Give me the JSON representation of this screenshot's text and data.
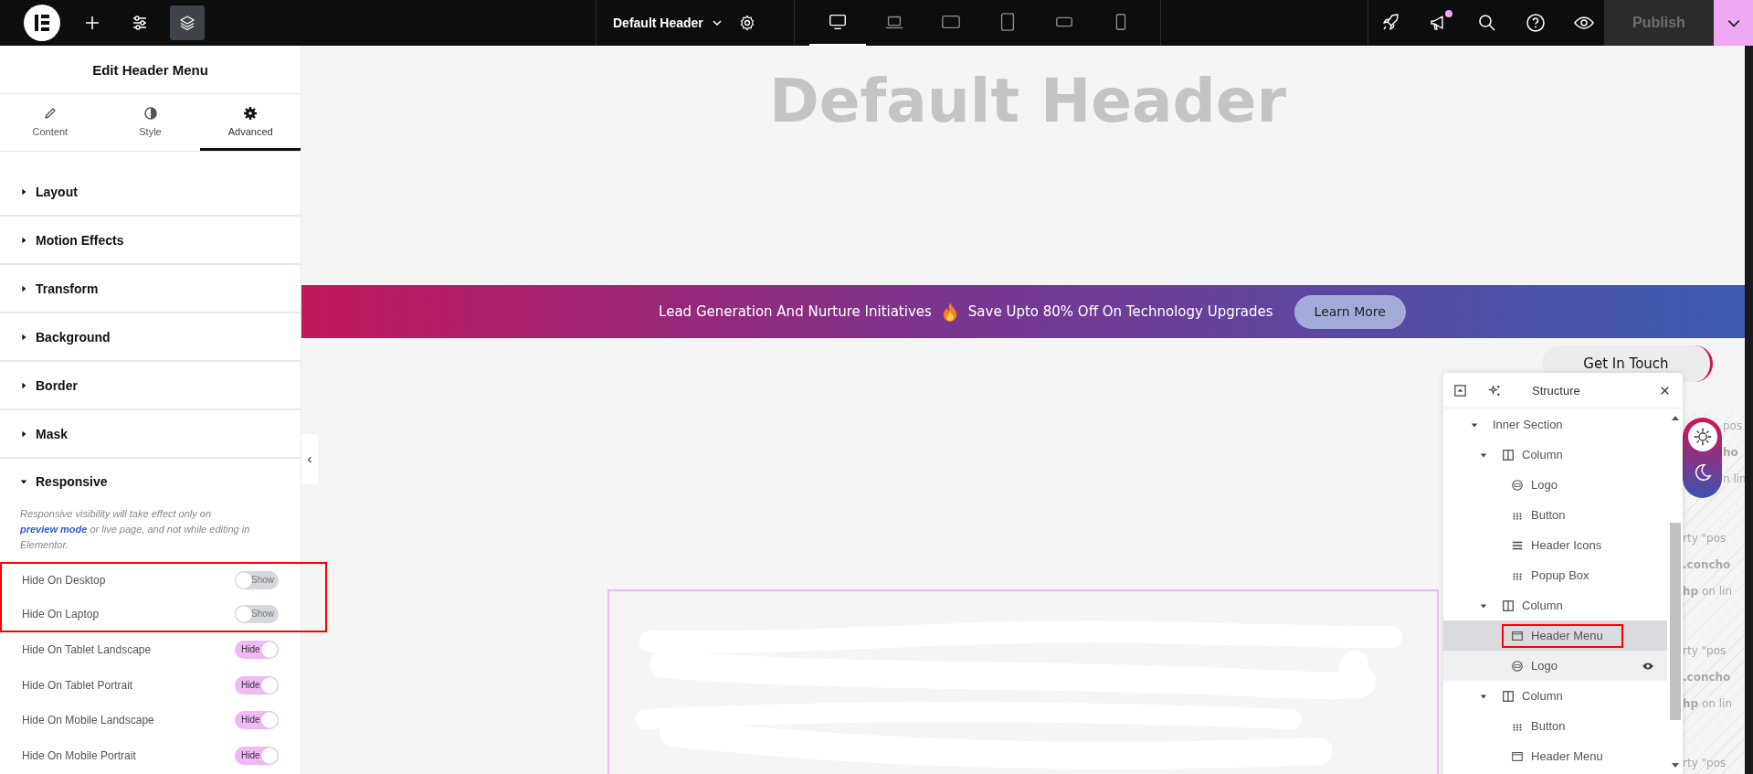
{
  "top_bar": {
    "tools": [
      {
        "kind": "add",
        "selected": false
      },
      {
        "kind": "sliders",
        "selected": false
      },
      {
        "kind": "layers",
        "selected": true
      }
    ],
    "document": {
      "title": "Default Header"
    },
    "devices": [
      {
        "kind": "desktop",
        "selected": true
      },
      {
        "kind": "laptop",
        "selected": false
      },
      {
        "kind": "tablet-landscape",
        "selected": false
      },
      {
        "kind": "tablet-portrait",
        "selected": false
      },
      {
        "kind": "mobile-landscape",
        "selected": false
      },
      {
        "kind": "mobile-portrait",
        "selected": false
      }
    ],
    "actions": [
      {
        "kind": "rocket",
        "badge": false
      },
      {
        "kind": "megaphone",
        "badge": true
      },
      {
        "kind": "search",
        "badge": false
      },
      {
        "kind": "help",
        "badge": false
      },
      {
        "kind": "eye",
        "badge": false
      }
    ],
    "publish": {
      "label": "Publish",
      "disabled": true
    }
  },
  "panel": {
    "title": "Edit Header Menu",
    "tabs": [
      {
        "label": "Content",
        "kind": "pencil",
        "selected": false
      },
      {
        "label": "Style",
        "kind": "contrast",
        "selected": false
      },
      {
        "label": "Advanced",
        "kind": "gear",
        "selected": true
      }
    ],
    "sections": [
      {
        "label": "Layout",
        "expanded": false
      },
      {
        "label": "Motion Effects",
        "expanded": false
      },
      {
        "label": "Transform",
        "expanded": false
      },
      {
        "label": "Background",
        "expanded": false
      },
      {
        "label": "Border",
        "expanded": false
      },
      {
        "label": "Mask",
        "expanded": false
      },
      {
        "label": "Responsive",
        "expanded": true
      }
    ],
    "note": {
      "before": "Responsive visibility will take effect only on ",
      "link": "preview mode",
      "after": " or live page, and not while editing in Elementor."
    },
    "toggles": [
      {
        "label": "Hide On Desktop",
        "state_label": "Show",
        "on": false,
        "highlighted": true
      },
      {
        "label": "Hide On Laptop",
        "state_label": "Show",
        "on": false,
        "highlighted": true
      },
      {
        "label": "Hide On Tablet Landscape",
        "state_label": "Hide",
        "on": true,
        "highlighted": false
      },
      {
        "label": "Hide On Tablet Portrait",
        "state_label": "Hide",
        "on": true,
        "highlighted": false
      },
      {
        "label": "Hide On Mobile Landscape",
        "state_label": "Hide",
        "on": true,
        "highlighted": false
      },
      {
        "label": "Hide On Mobile Portrait",
        "state_label": "Hide",
        "on": true,
        "highlighted": false
      }
    ]
  },
  "canvas": {
    "heading": "Default Header",
    "banner": {
      "text_1": "Lead Generation And Nurture Initiatives",
      "text_2": "Save Upto 80% Off On Technology Upgrades",
      "button": "Learn More"
    },
    "contact_button": "Get In Touch",
    "theme_switch": {
      "dark": false
    },
    "background_fragments": [
      [
        "pos",
        "**ho**",
        "n lin"
      ],
      [
        "rty \"pos",
        "**.concho**",
        "**hp** on lin"
      ],
      [
        "rty \"pos",
        "**.concho**",
        "**hp** on lin"
      ],
      [
        "rty \"pos"
      ]
    ]
  },
  "structure": {
    "title": "Structure",
    "tree": [
      {
        "label": "Inner Section",
        "kind": "section",
        "expanded": true,
        "selected": false,
        "hovered": false,
        "highlighted": false,
        "children": [
          {
            "label": "Column",
            "kind": "column",
            "expanded": true,
            "selected": false,
            "hovered": false,
            "highlighted": false,
            "children": [
              {
                "label": "Logo",
                "kind": "image",
                "selected": false,
                "hovered": false,
                "highlighted": false
              },
              {
                "label": "Button",
                "kind": "button",
                "selected": false,
                "hovered": false,
                "highlighted": false
              },
              {
                "label": "Header Icons",
                "kind": "menu",
                "selected": false,
                "hovered": false,
                "highlighted": false
              },
              {
                "label": "Popup Box",
                "kind": "button",
                "selected": false,
                "hovered": false,
                "highlighted": false
              }
            ]
          },
          {
            "label": "Column",
            "kind": "column",
            "expanded": true,
            "selected": false,
            "hovered": false,
            "highlighted": false,
            "children": [
              {
                "label": "Header Menu",
                "kind": "window",
                "selected": true,
                "hovered": false,
                "highlighted": true
              },
              {
                "label": "Logo",
                "kind": "image",
                "selected": false,
                "hovered": true,
                "highlighted": false
              }
            ]
          },
          {
            "label": "Column",
            "kind": "column",
            "expanded": true,
            "selected": false,
            "hovered": false,
            "highlighted": false,
            "children": [
              {
                "label": "Button",
                "kind": "button",
                "selected": false,
                "hovered": false,
                "highlighted": false
              },
              {
                "label": "Header Menu",
                "kind": "window",
                "selected": false,
                "hovered": false,
                "highlighted": false
              }
            ]
          }
        ]
      }
    ]
  }
}
